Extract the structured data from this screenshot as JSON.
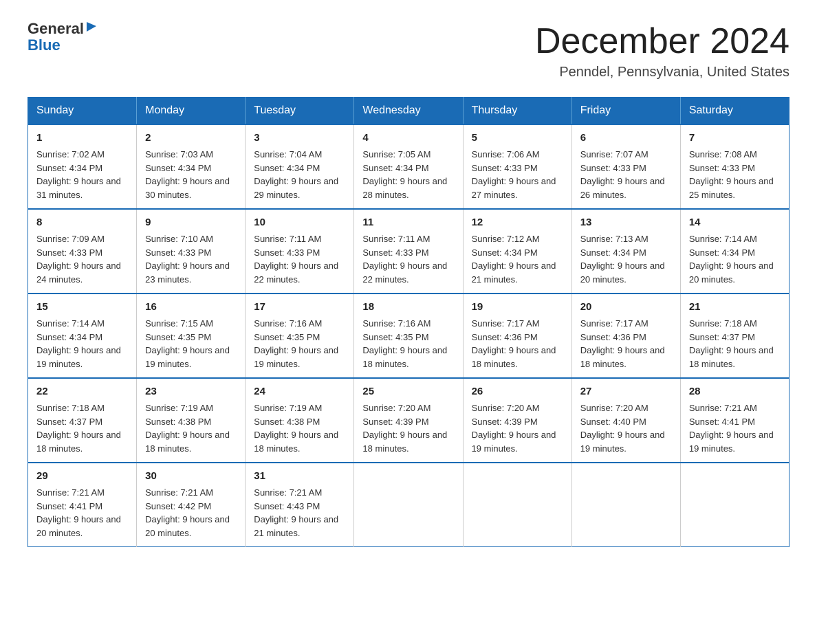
{
  "logo": {
    "general": "General",
    "flag_shape": "▶",
    "blue": "Blue"
  },
  "title": "December 2024",
  "subtitle": "Penndel, Pennsylvania, United States",
  "days_of_week": [
    "Sunday",
    "Monday",
    "Tuesday",
    "Wednesday",
    "Thursday",
    "Friday",
    "Saturday"
  ],
  "weeks": [
    [
      {
        "day": "1",
        "sunrise": "7:02 AM",
        "sunset": "4:34 PM",
        "daylight": "9 hours and 31 minutes."
      },
      {
        "day": "2",
        "sunrise": "7:03 AM",
        "sunset": "4:34 PM",
        "daylight": "9 hours and 30 minutes."
      },
      {
        "day": "3",
        "sunrise": "7:04 AM",
        "sunset": "4:34 PM",
        "daylight": "9 hours and 29 minutes."
      },
      {
        "day": "4",
        "sunrise": "7:05 AM",
        "sunset": "4:34 PM",
        "daylight": "9 hours and 28 minutes."
      },
      {
        "day": "5",
        "sunrise": "7:06 AM",
        "sunset": "4:33 PM",
        "daylight": "9 hours and 27 minutes."
      },
      {
        "day": "6",
        "sunrise": "7:07 AM",
        "sunset": "4:33 PM",
        "daylight": "9 hours and 26 minutes."
      },
      {
        "day": "7",
        "sunrise": "7:08 AM",
        "sunset": "4:33 PM",
        "daylight": "9 hours and 25 minutes."
      }
    ],
    [
      {
        "day": "8",
        "sunrise": "7:09 AM",
        "sunset": "4:33 PM",
        "daylight": "9 hours and 24 minutes."
      },
      {
        "day": "9",
        "sunrise": "7:10 AM",
        "sunset": "4:33 PM",
        "daylight": "9 hours and 23 minutes."
      },
      {
        "day": "10",
        "sunrise": "7:11 AM",
        "sunset": "4:33 PM",
        "daylight": "9 hours and 22 minutes."
      },
      {
        "day": "11",
        "sunrise": "7:11 AM",
        "sunset": "4:33 PM",
        "daylight": "9 hours and 22 minutes."
      },
      {
        "day": "12",
        "sunrise": "7:12 AM",
        "sunset": "4:34 PM",
        "daylight": "9 hours and 21 minutes."
      },
      {
        "day": "13",
        "sunrise": "7:13 AM",
        "sunset": "4:34 PM",
        "daylight": "9 hours and 20 minutes."
      },
      {
        "day": "14",
        "sunrise": "7:14 AM",
        "sunset": "4:34 PM",
        "daylight": "9 hours and 20 minutes."
      }
    ],
    [
      {
        "day": "15",
        "sunrise": "7:14 AM",
        "sunset": "4:34 PM",
        "daylight": "9 hours and 19 minutes."
      },
      {
        "day": "16",
        "sunrise": "7:15 AM",
        "sunset": "4:35 PM",
        "daylight": "9 hours and 19 minutes."
      },
      {
        "day": "17",
        "sunrise": "7:16 AM",
        "sunset": "4:35 PM",
        "daylight": "9 hours and 19 minutes."
      },
      {
        "day": "18",
        "sunrise": "7:16 AM",
        "sunset": "4:35 PM",
        "daylight": "9 hours and 18 minutes."
      },
      {
        "day": "19",
        "sunrise": "7:17 AM",
        "sunset": "4:36 PM",
        "daylight": "9 hours and 18 minutes."
      },
      {
        "day": "20",
        "sunrise": "7:17 AM",
        "sunset": "4:36 PM",
        "daylight": "9 hours and 18 minutes."
      },
      {
        "day": "21",
        "sunrise": "7:18 AM",
        "sunset": "4:37 PM",
        "daylight": "9 hours and 18 minutes."
      }
    ],
    [
      {
        "day": "22",
        "sunrise": "7:18 AM",
        "sunset": "4:37 PM",
        "daylight": "9 hours and 18 minutes."
      },
      {
        "day": "23",
        "sunrise": "7:19 AM",
        "sunset": "4:38 PM",
        "daylight": "9 hours and 18 minutes."
      },
      {
        "day": "24",
        "sunrise": "7:19 AM",
        "sunset": "4:38 PM",
        "daylight": "9 hours and 18 minutes."
      },
      {
        "day": "25",
        "sunrise": "7:20 AM",
        "sunset": "4:39 PM",
        "daylight": "9 hours and 18 minutes."
      },
      {
        "day": "26",
        "sunrise": "7:20 AM",
        "sunset": "4:39 PM",
        "daylight": "9 hours and 19 minutes."
      },
      {
        "day": "27",
        "sunrise": "7:20 AM",
        "sunset": "4:40 PM",
        "daylight": "9 hours and 19 minutes."
      },
      {
        "day": "28",
        "sunrise": "7:21 AM",
        "sunset": "4:41 PM",
        "daylight": "9 hours and 19 minutes."
      }
    ],
    [
      {
        "day": "29",
        "sunrise": "7:21 AM",
        "sunset": "4:41 PM",
        "daylight": "9 hours and 20 minutes."
      },
      {
        "day": "30",
        "sunrise": "7:21 AM",
        "sunset": "4:42 PM",
        "daylight": "9 hours and 20 minutes."
      },
      {
        "day": "31",
        "sunrise": "7:21 AM",
        "sunset": "4:43 PM",
        "daylight": "9 hours and 21 minutes."
      },
      null,
      null,
      null,
      null
    ]
  ]
}
